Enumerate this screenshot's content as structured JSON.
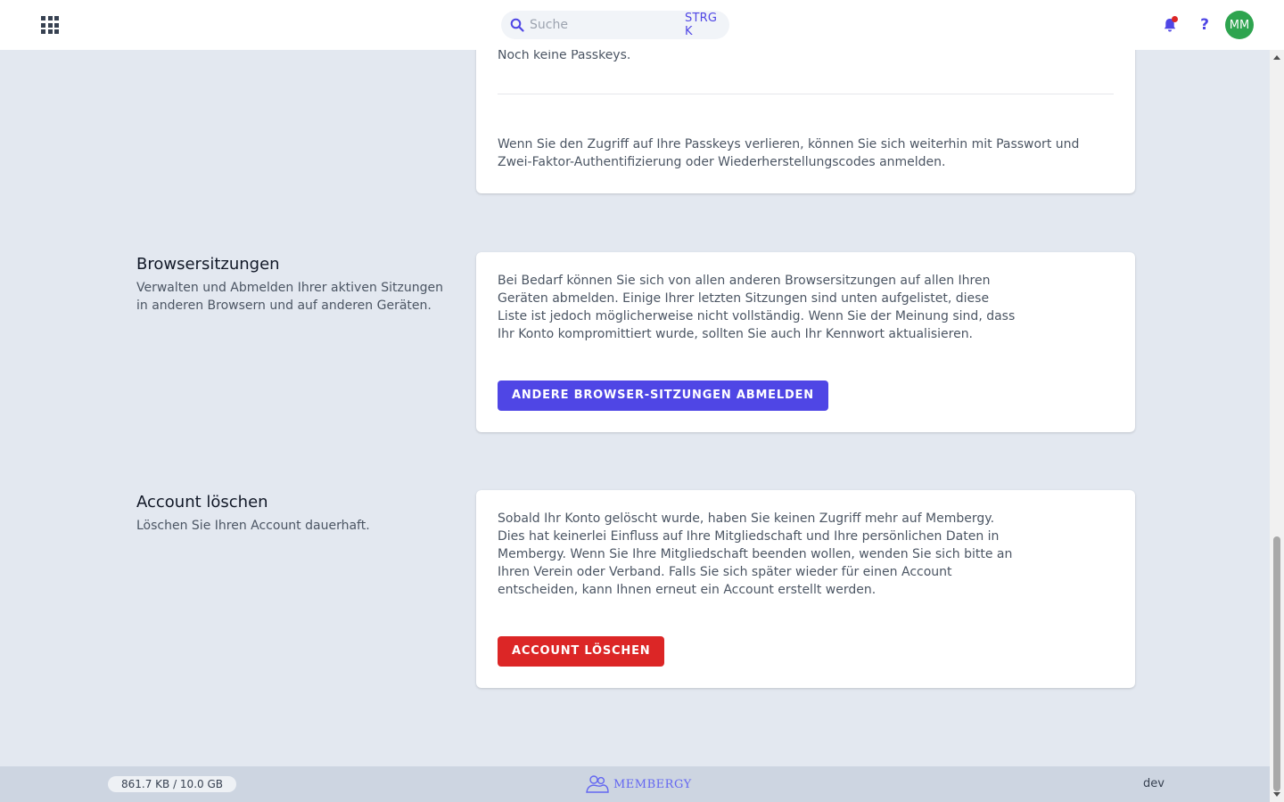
{
  "header": {
    "search_placeholder": "Suche",
    "search_shortcut": "STRG K",
    "avatar_initials": "MM",
    "help_label": "?",
    "icons": {
      "apps": "grid-icon",
      "search": "search-icon",
      "notifications": "bell-icon"
    }
  },
  "passkeys": {
    "empty_text": "Noch keine Passkeys.",
    "info_text": "Wenn Sie den Zugriff auf Ihre Passkeys verlieren, können Sie sich weiterhin mit Passwort und Zwei-Faktor-Authentifizierung oder Wiederherstellungscodes anmelden."
  },
  "browser_sessions": {
    "title": "Browsersitzungen",
    "description": "Verwalten und Abmelden Ihrer aktiven Sitzungen in anderen Browsern und auf anderen Geräten.",
    "body": "Bei Bedarf können Sie sich von allen anderen Browsersitzungen auf allen Ihren Geräten abmelden. Einige Ihrer letzten Sitzungen sind unten aufgelistet, diese Liste ist jedoch möglicherweise nicht vollständig. Wenn Sie der Meinung sind, dass Ihr Konto kompromittiert wurde, sollten Sie auch Ihr Kennwort aktualisieren.",
    "button_label": "ANDERE BROWSER-SITZUNGEN ABMELDEN"
  },
  "delete_account": {
    "title": "Account löschen",
    "description": "Löschen Sie Ihren Account dauerhaft.",
    "body": "Sobald Ihr Konto gelöscht wurde, haben Sie keinen Zugriff mehr auf Membergy. Dies hat keinerlei Einfluss auf Ihre Mitgliedschaft und Ihre persönlichen Daten in Membergy. Wenn Sie Ihre Mitgliedschaft beenden wollen, wenden Sie sich bitte an Ihren Verein oder Verband. Falls Sie sich später wieder für einen Account entscheiden, kann Ihnen erneut ein Account erstellt werden.",
    "button_label": "ACCOUNT LÖSCHEN"
  },
  "footer": {
    "storage": "861.7 KB / 10.0 GB",
    "brand": "MEMBERGY",
    "environment": "dev"
  },
  "colors": {
    "primary": "#4f46e5",
    "danger": "#dc2626",
    "avatar": "#2ea44f",
    "background": "#e3e8f0",
    "footer": "#cdd5e1"
  }
}
